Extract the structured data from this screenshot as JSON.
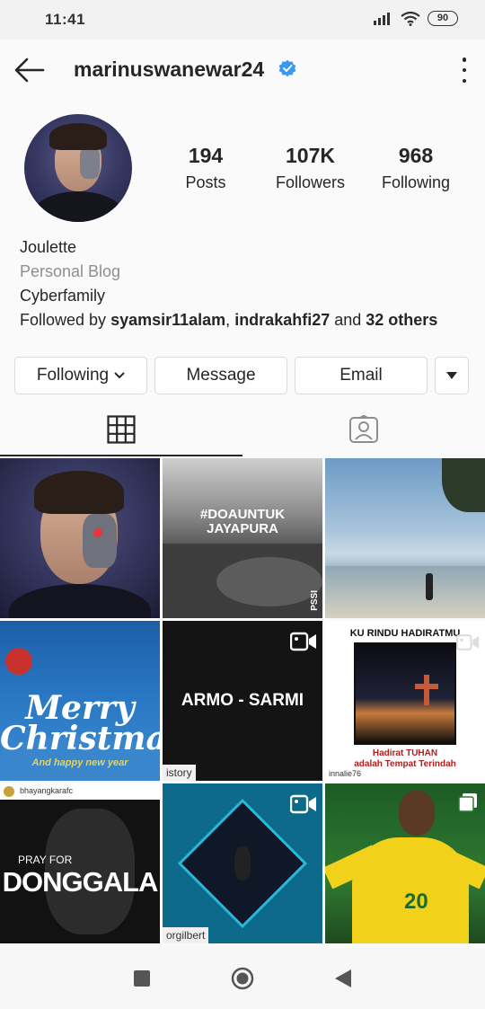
{
  "status_bar": {
    "time": "11:41",
    "battery": "90"
  },
  "header": {
    "username": "marinuswanewar24",
    "verified_icon": "verified-badge-icon",
    "back_icon": "back-arrow-icon",
    "more_icon": "more-vertical-icon"
  },
  "profile": {
    "stats": [
      {
        "value": "194",
        "label": "Posts"
      },
      {
        "value": "107K",
        "label": "Followers"
      },
      {
        "value": "968",
        "label": "Following"
      }
    ],
    "name": "Joulette",
    "category": "Personal Blog",
    "bio": "Cyberfamily",
    "followed_by_prefix": "Followed by ",
    "followed_by_1": "syamsir11alam",
    "followed_by_sep": ", ",
    "followed_by_2": "indrakahfi27",
    "followed_by_and": " and ",
    "followed_by_others": "32 others"
  },
  "actions": {
    "following": "Following",
    "message": "Message",
    "email": "Email"
  },
  "tabs": [
    {
      "icon": "grid-icon"
    },
    {
      "icon": "tagged-icon"
    }
  ],
  "posts": [
    {
      "overlay_text": "",
      "type": "photo"
    },
    {
      "overlay_text": "#DOAUNTUK JAYAPURA",
      "corner_text": "PSSI",
      "type": "photo"
    },
    {
      "overlay_text": "",
      "type": "photo"
    },
    {
      "overlay_text": "Merry Christmas!",
      "sub_text": "And happy new year",
      "type": "photo"
    },
    {
      "overlay_text": "ARMO - SARMI",
      "corner_text": "istory",
      "type": "video"
    },
    {
      "overlay_text": "KU RINDU HADIRATMU",
      "sub_text": "Hadirat TUHAN",
      "sub_text_2": "adalah Tempat Terindah",
      "user_tag": "innalie76",
      "type": "video"
    },
    {
      "overlay_text": "PRAY FOR",
      "overlay_text_2": "DONGGALA",
      "user_tag": "bhayangkarafc",
      "type": "photo"
    },
    {
      "overlay_text": "",
      "corner_text": "orgilbert",
      "type": "video"
    },
    {
      "overlay_text": "",
      "number": "20",
      "type": "carousel"
    }
  ],
  "colors": {
    "accent": "#3897f0",
    "text": "#262626",
    "muted": "#8e8e8e",
    "border": "#dbdbdb"
  }
}
